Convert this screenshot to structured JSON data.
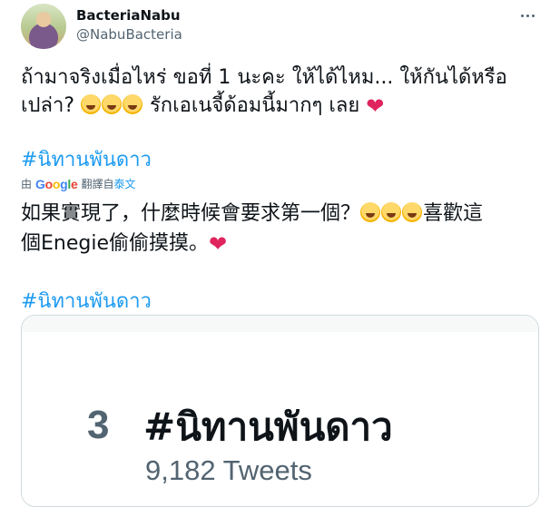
{
  "author": {
    "name": "BacteriaNabu",
    "handle": "@NabuBacteria"
  },
  "tweet": {
    "line1": "ถ้ามาจริงเมื่อไหร่ ขอที่ 1 นะคะ ให้ได้ไหม... ให้กันได้หรือ",
    "line2_before": "เปล่า? ",
    "line2_after": " รักเอเนจี้ด้อมนี้มากๆ เลย ",
    "hashtag": "#นิทานพันดาว"
  },
  "translation": {
    "prefix": "由",
    "google": "Google",
    "label": "翻譯自",
    "language": "泰文",
    "line1_before": "如果實現了，什麼時候會要求第一個？",
    "line1_after": "喜歡這",
    "line2": "個Enegie偷偷摸摸。",
    "hashtag": "#นิทานพันดาว"
  },
  "card": {
    "rank": "3",
    "trend": "#นิทานพันดาว",
    "count": "9,182 Tweets"
  },
  "icons": {
    "more": "more-horizontal-icon",
    "emoji": "rolling-on-floor-laughing-emoji",
    "heart": "red-heart-emoji",
    "globe": "globe-icon"
  },
  "colors": {
    "accent": "#1d9bf0",
    "heart": "#e0245e",
    "muted": "#536471"
  }
}
